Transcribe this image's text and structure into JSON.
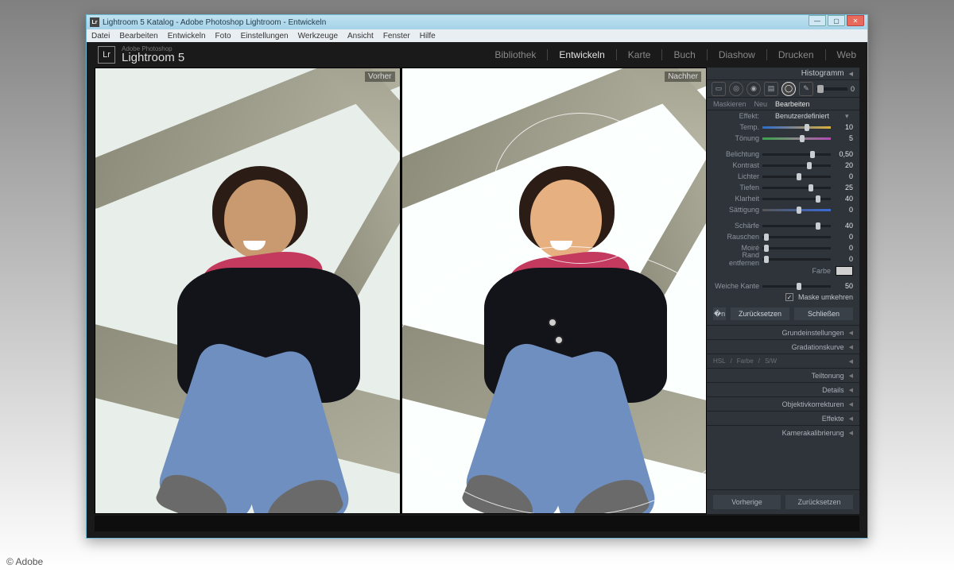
{
  "credit": "© Adobe",
  "window": {
    "title": "Lightroom 5 Katalog - Adobe Photoshop Lightroom - Entwickeln"
  },
  "menu": [
    "Datei",
    "Bearbeiten",
    "Entwickeln",
    "Foto",
    "Einstellungen",
    "Werkzeuge",
    "Ansicht",
    "Fenster",
    "Hilfe"
  ],
  "header": {
    "logo": "Lr",
    "subtitle": "Adobe Photoshop",
    "product": "Lightroom 5"
  },
  "modules": [
    "Bibliothek",
    "Entwickeln",
    "Karte",
    "Buch",
    "Diashow",
    "Drucken",
    "Web"
  ],
  "active_module": "Entwickeln",
  "compare": {
    "before": "Vorher",
    "after": "Nachher"
  },
  "mini_slider_value": 0,
  "panel": {
    "histogram": "Histogramm",
    "mask_tabs": {
      "mask": "Maskieren",
      "new": "Neu",
      "edit": "Bearbeiten"
    },
    "effect_label": "Effekt:",
    "effect_preset": "Benutzerdefiniert",
    "sliders": {
      "temp": {
        "label": "Temp.",
        "value": 10,
        "pos": 0.62
      },
      "tint": {
        "label": "Tönung",
        "value": 5,
        "pos": 0.55
      },
      "exposure": {
        "label": "Belichtung",
        "value": "0,50",
        "pos": 0.7
      },
      "contrast": {
        "label": "Kontrast",
        "value": 20,
        "pos": 0.65
      },
      "highlights": {
        "label": "Lichter",
        "value": 0,
        "pos": 0.5
      },
      "shadows": {
        "label": "Tiefen",
        "value": 25,
        "pos": 0.68
      },
      "clarity": {
        "label": "Klarheit",
        "value": 40,
        "pos": 0.78
      },
      "saturation": {
        "label": "Sättigung",
        "value": 0,
        "pos": 0.5
      },
      "sharpness": {
        "label": "Schärfe",
        "value": 40,
        "pos": 0.78
      },
      "noise": {
        "label": "Rauschen",
        "value": 0,
        "pos": 0.02
      },
      "moire": {
        "label": "Moiré",
        "value": 0,
        "pos": 0.02
      },
      "defringe": {
        "label": "Rand entfernen",
        "value": 0,
        "pos": 0.02
      }
    },
    "color_label": "Farbe",
    "feather": {
      "label": "Weiche Kante",
      "value": 50,
      "pos": 0.5
    },
    "invert": {
      "label": "Maske umkehren",
      "checked": true
    },
    "reset": "Zurücksetzen",
    "close": "Schließen",
    "sections": [
      {
        "label": "Grundeinstellungen"
      },
      {
        "label": "Gradationskurve"
      },
      {
        "label": "HSL",
        "segs": [
          "HSL",
          "Farbe",
          "S/W"
        ]
      },
      {
        "label": "Teiltonung"
      },
      {
        "label": "Details"
      },
      {
        "label": "Objektivkorrekturen"
      },
      {
        "label": "Effekte"
      },
      {
        "label": "Kamerakalibrierung"
      }
    ],
    "footer": {
      "prev": "Vorherige",
      "reset": "Zurücksetzen"
    }
  }
}
